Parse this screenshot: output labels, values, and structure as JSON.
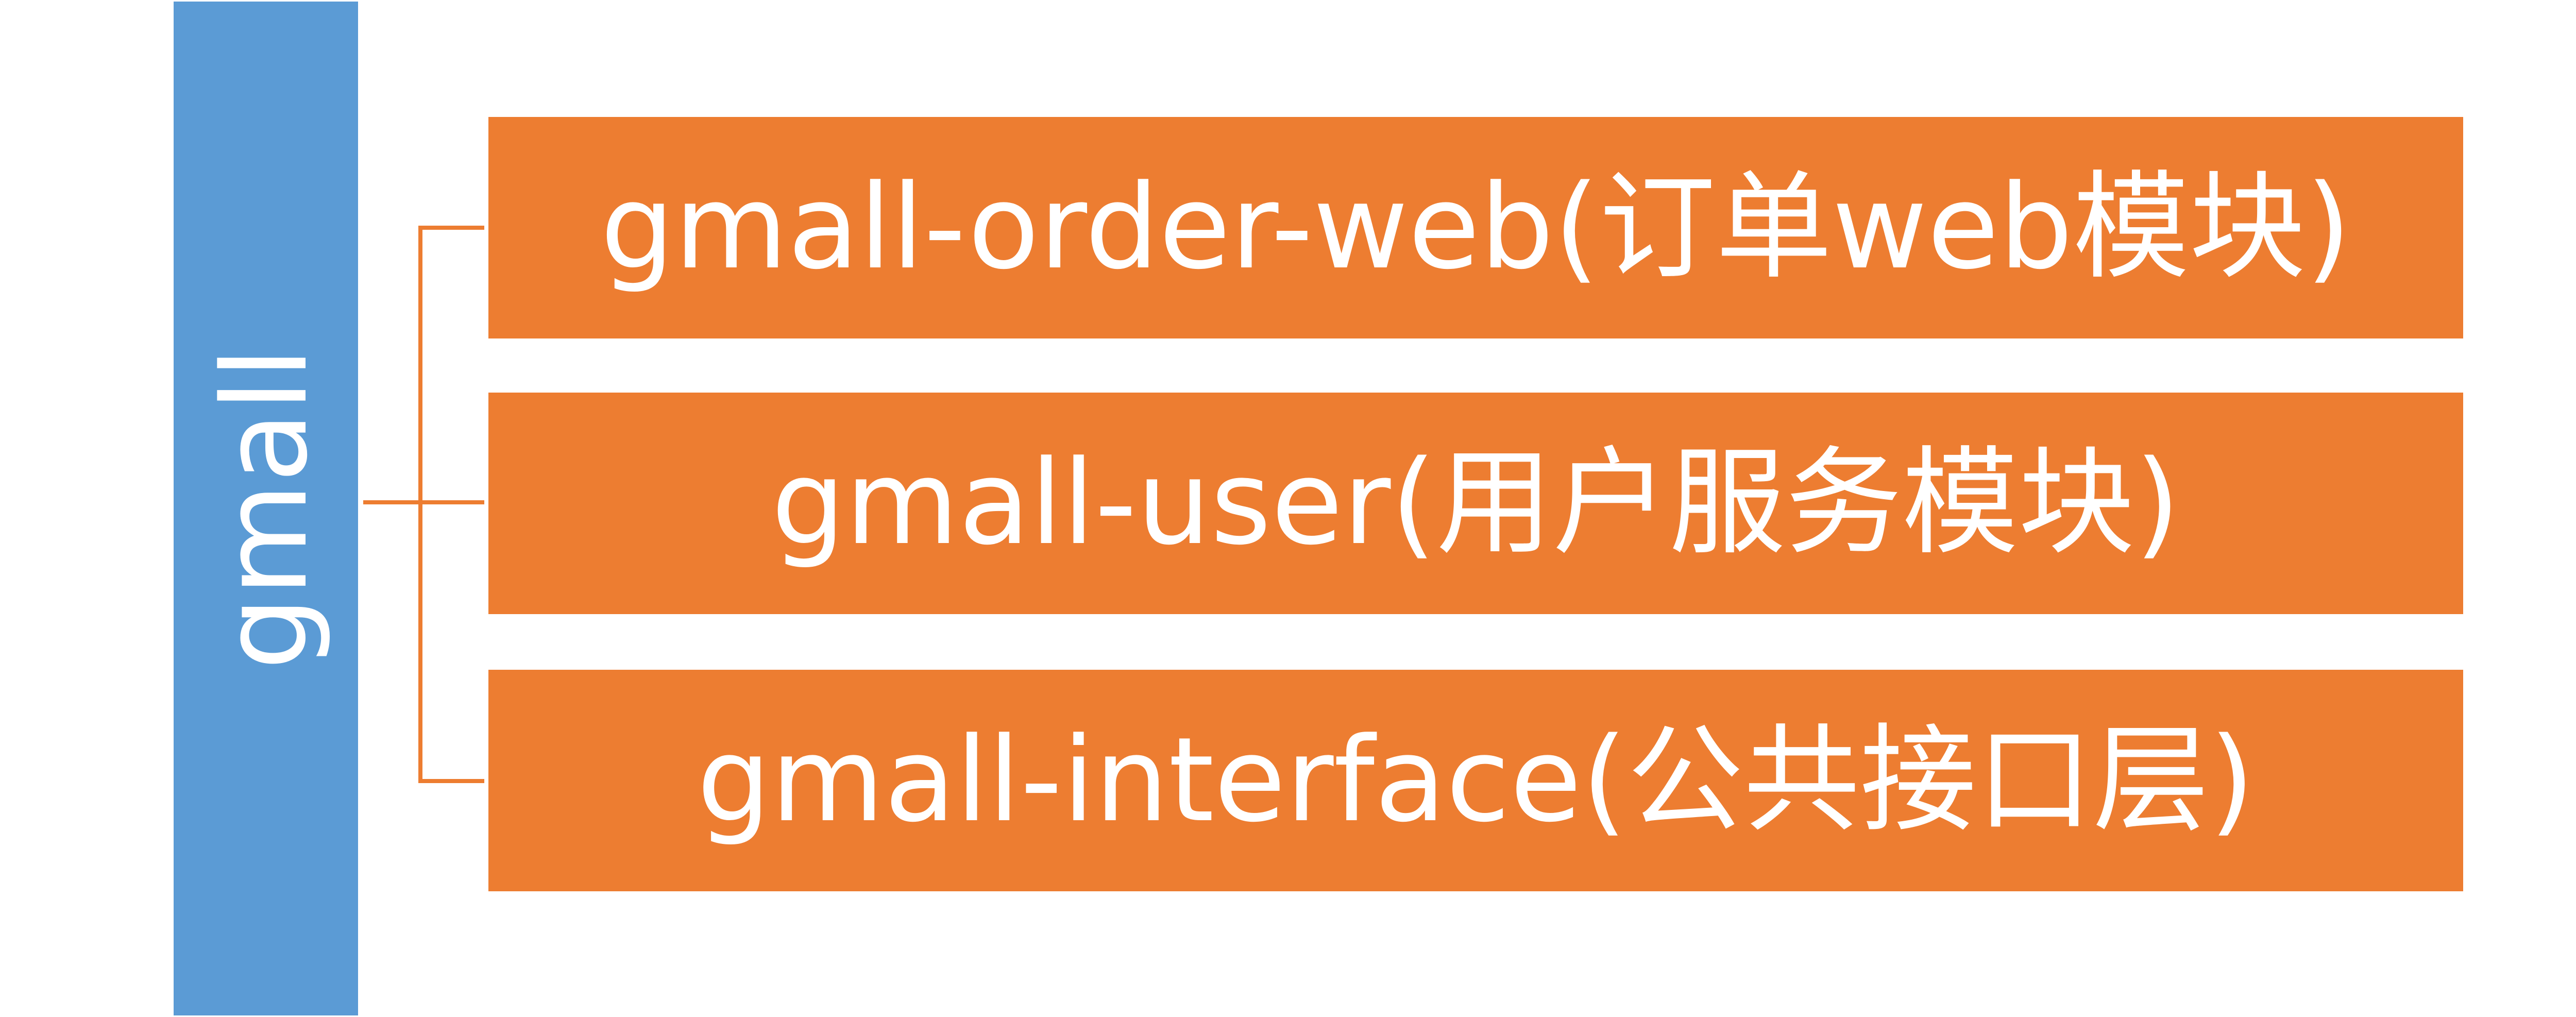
{
  "root": {
    "label": "gmall"
  },
  "modules": [
    {
      "label": "gmall-order-web(订单web模块)"
    },
    {
      "label": "gmall-user(用户服务模块)"
    },
    {
      "label": "gmall-interface(公共接口层)"
    }
  ],
  "colors": {
    "root_bar": "#5b9bd5",
    "module_box": "#ed7d31",
    "connector": "#ed7d31",
    "text": "#ffffff",
    "background": "#ffffff"
  }
}
